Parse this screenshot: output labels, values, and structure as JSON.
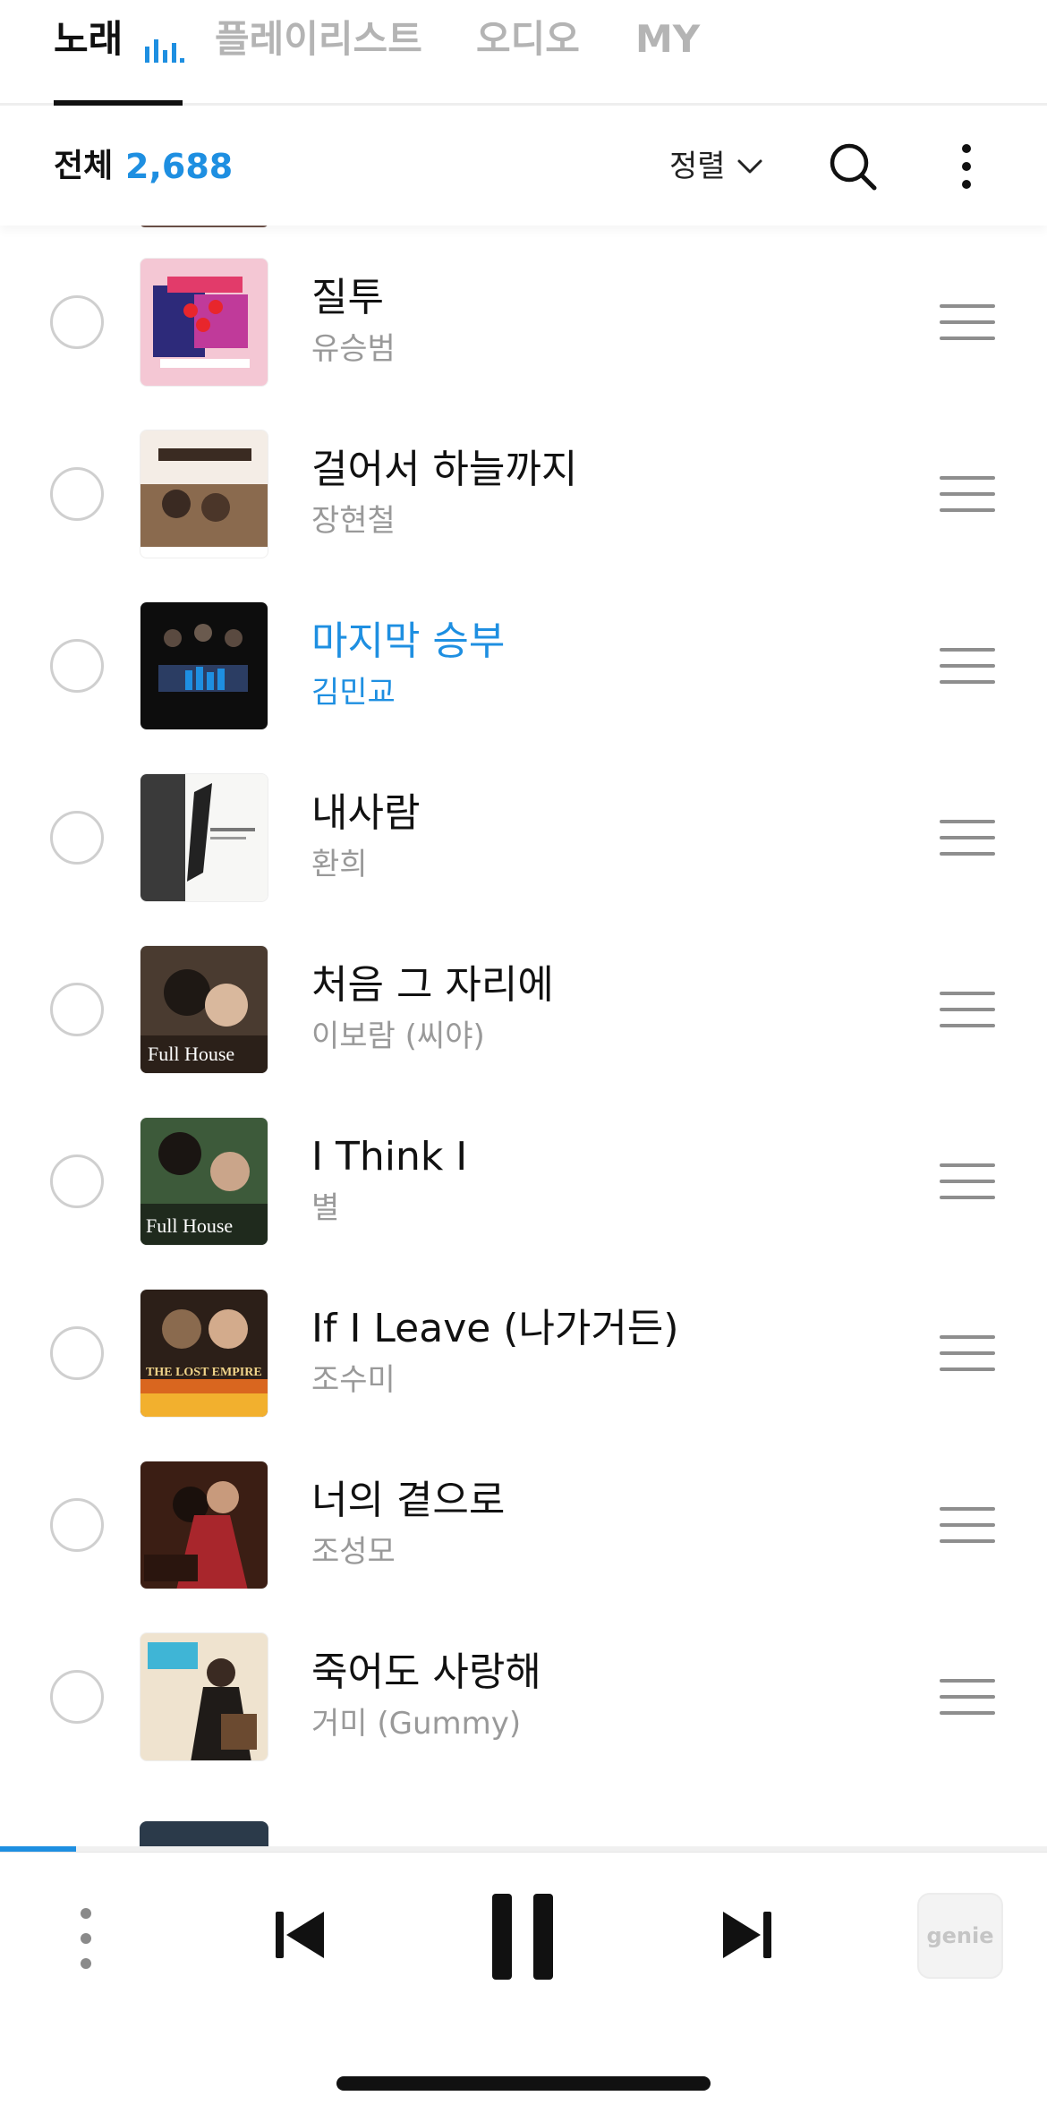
{
  "tabs": [
    {
      "label": "노래",
      "active": true
    },
    {
      "label": "플레이리스트",
      "active": false
    },
    {
      "label": "오디오",
      "active": false
    },
    {
      "label": "MY",
      "active": false
    }
  ],
  "header": {
    "total_label": "전체",
    "total_count": "2,688",
    "sort_label": "정렬",
    "sort_icon": "chevron-down-icon",
    "search_icon": "search-icon",
    "more_icon": "more-vertical-icon"
  },
  "songs": [
    {
      "title": "질투",
      "artist": "유승범",
      "playing": false
    },
    {
      "title": "걸어서 하늘까지",
      "artist": "장현철",
      "playing": false
    },
    {
      "title": "마지막 승부",
      "artist": "김민교",
      "playing": true
    },
    {
      "title": "내사람",
      "artist": "환희",
      "playing": false
    },
    {
      "title": "처음 그 자리에",
      "artist": "이보람 (씨야)",
      "playing": false
    },
    {
      "title": "I Think I",
      "artist": "별",
      "playing": false
    },
    {
      "title": "If I Leave (나가거든)",
      "artist": "조수미",
      "playing": false
    },
    {
      "title": "너의 곁으로",
      "artist": "조성모",
      "playing": false
    },
    {
      "title": "죽어도 사랑해",
      "artist": "거미 (Gummy)",
      "playing": false
    }
  ],
  "covers": {
    "album_5_text": "Full House",
    "album_6_text": "Full House",
    "album_7_text": "THE LOST EMPIRE"
  },
  "player": {
    "progress": 0.073,
    "logo": "genie",
    "icons": [
      "more-vertical-icon",
      "previous-icon",
      "pause-icon",
      "next-icon"
    ]
  },
  "colors": {
    "accent": "#1e8fe1",
    "text_primary": "#111111",
    "text_secondary": "#999999",
    "tab_inactive": "#b4b4b4"
  }
}
